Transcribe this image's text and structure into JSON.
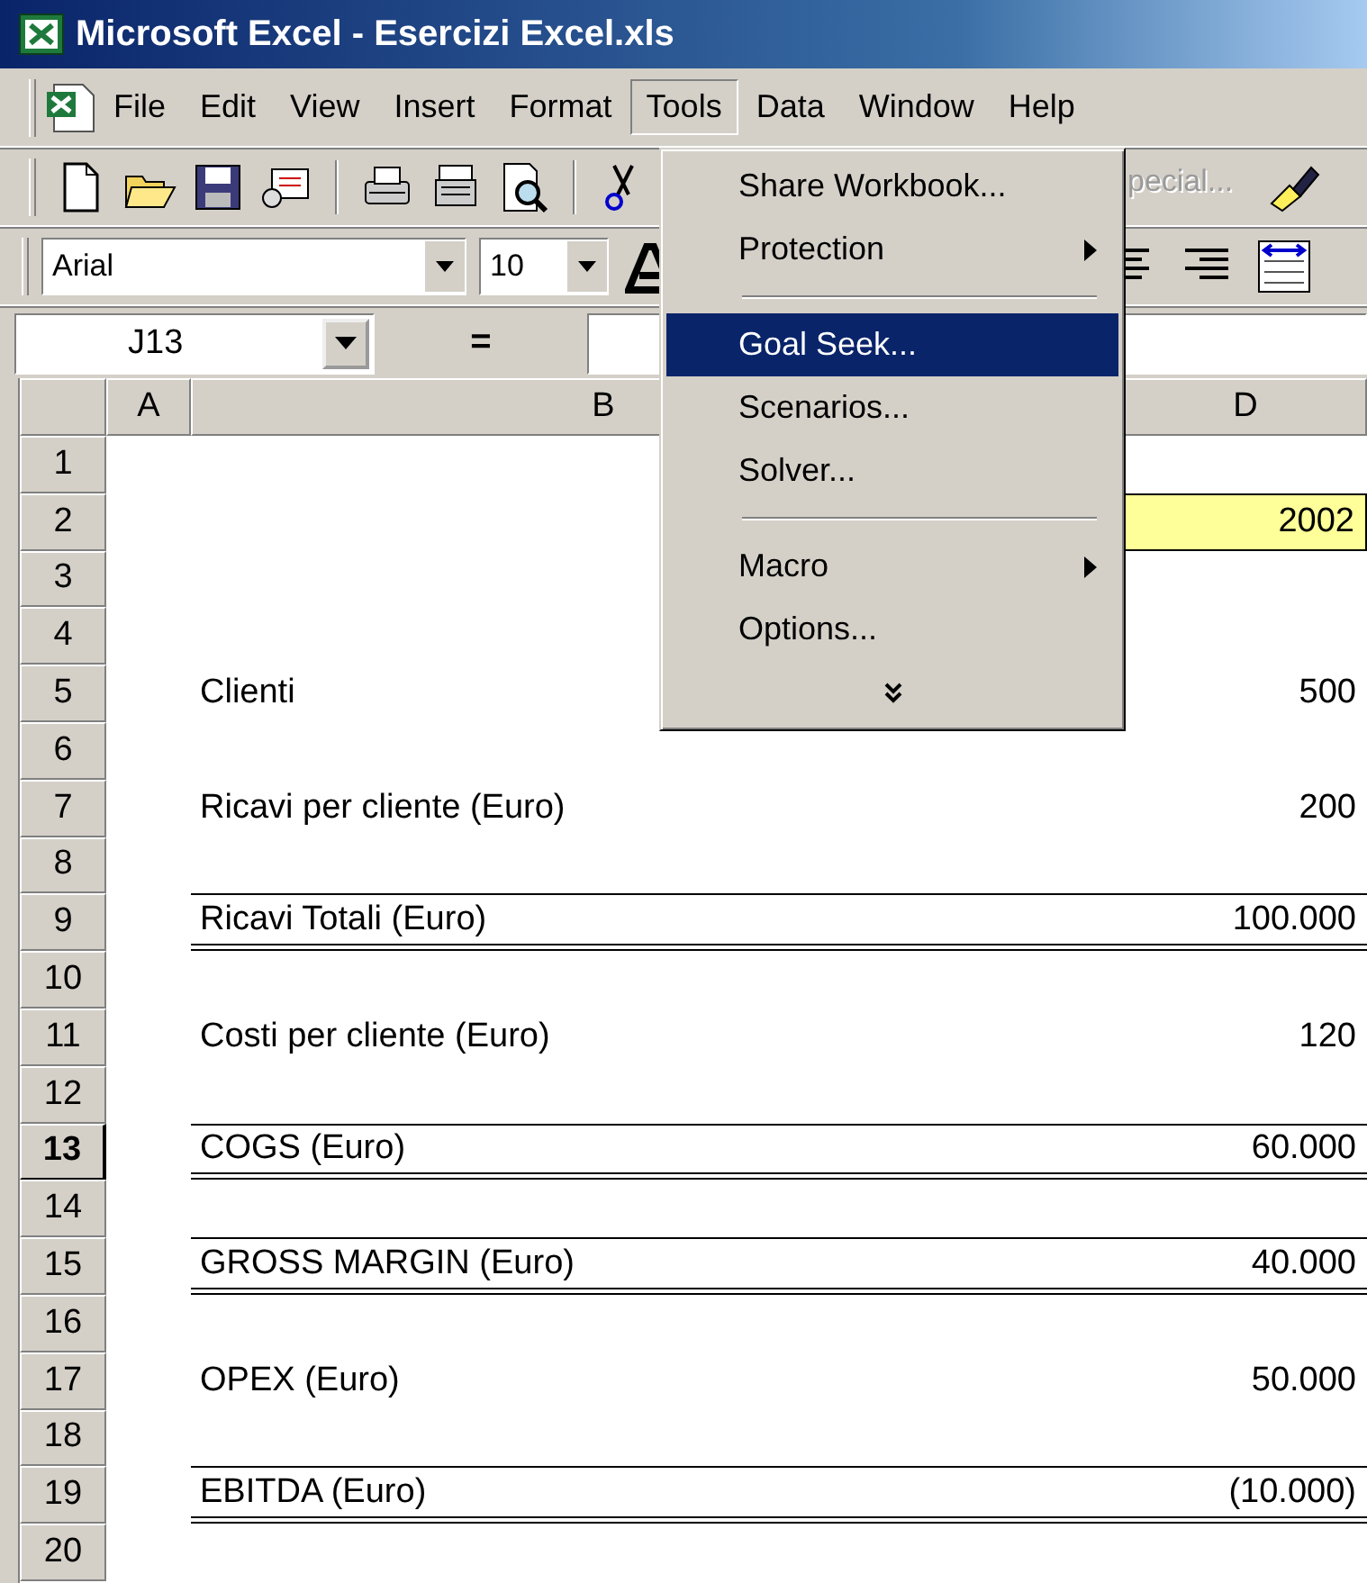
{
  "window": {
    "title": "Microsoft Excel - Esercizi Excel.xls"
  },
  "menu_bar": [
    {
      "label": "File",
      "open": false
    },
    {
      "label": "Edit",
      "open": false
    },
    {
      "label": "View",
      "open": false
    },
    {
      "label": "Insert",
      "open": false
    },
    {
      "label": "Format",
      "open": false
    },
    {
      "label": "Tools",
      "open": true
    },
    {
      "label": "Data",
      "open": false
    },
    {
      "label": "Window",
      "open": false
    },
    {
      "label": "Help",
      "open": false
    }
  ],
  "standard_toolbar": {
    "partial_label": "pecial...",
    "partial_label_disabled": true
  },
  "formatting_toolbar": {
    "font": "Arial",
    "size": "10"
  },
  "formula_bar": {
    "name_box": "J13",
    "equals": "="
  },
  "sheet": {
    "columns": [
      {
        "label": "A"
      },
      {
        "label": "B"
      },
      {
        "label": "D"
      }
    ],
    "rows": [
      {
        "number": "1",
        "selected": false,
        "kind": "blank"
      },
      {
        "number": "2",
        "selected": false,
        "kind": "input",
        "value": "2002"
      },
      {
        "number": "3",
        "selected": false,
        "kind": "blank"
      },
      {
        "number": "4",
        "selected": false,
        "kind": "blank"
      },
      {
        "number": "5",
        "selected": false,
        "kind": "plain",
        "label": "Clienti",
        "value": "500"
      },
      {
        "number": "6",
        "selected": false,
        "kind": "blank"
      },
      {
        "number": "7",
        "selected": false,
        "kind": "plain",
        "label": "Ricavi per cliente (Euro)",
        "value": "200"
      },
      {
        "number": "8",
        "selected": false,
        "kind": "blank"
      },
      {
        "number": "9",
        "selected": false,
        "kind": "total",
        "label": "Ricavi Totali (Euro)",
        "value": "100.000"
      },
      {
        "number": "10",
        "selected": false,
        "kind": "blank"
      },
      {
        "number": "11",
        "selected": false,
        "kind": "plain",
        "label": "Costi per cliente (Euro)",
        "value": "120"
      },
      {
        "number": "12",
        "selected": false,
        "kind": "blank"
      },
      {
        "number": "13",
        "selected": true,
        "kind": "total",
        "label": "COGS (Euro)",
        "value": "60.000"
      },
      {
        "number": "14",
        "selected": false,
        "kind": "blank"
      },
      {
        "number": "15",
        "selected": false,
        "kind": "total",
        "label": "GROSS MARGIN (Euro)",
        "value": "40.000"
      },
      {
        "number": "16",
        "selected": false,
        "kind": "blank"
      },
      {
        "number": "17",
        "selected": false,
        "kind": "plain",
        "label": "OPEX (Euro)",
        "value": "50.000"
      },
      {
        "number": "18",
        "selected": false,
        "kind": "blank"
      },
      {
        "number": "19",
        "selected": false,
        "kind": "total",
        "label": "EBITDA (Euro)",
        "value": "(10.000)"
      },
      {
        "number": "20",
        "selected": false,
        "kind": "blank"
      }
    ]
  },
  "tools_menu": {
    "items": [
      {
        "kind": "item",
        "label": "Share Workbook...",
        "submenu": false,
        "selected": false
      },
      {
        "kind": "item",
        "label": "Protection",
        "submenu": true,
        "selected": false
      },
      {
        "kind": "separator"
      },
      {
        "kind": "item",
        "label": "Goal Seek...",
        "submenu": false,
        "selected": true
      },
      {
        "kind": "item",
        "label": "Scenarios...",
        "submenu": false,
        "selected": false
      },
      {
        "kind": "item",
        "label": "Solver...",
        "submenu": false,
        "selected": false
      },
      {
        "kind": "separator"
      },
      {
        "kind": "item",
        "label": "Macro",
        "submenu": true,
        "selected": false
      },
      {
        "kind": "item",
        "label": "Options...",
        "submenu": false,
        "selected": false
      },
      {
        "kind": "expand"
      }
    ]
  }
}
